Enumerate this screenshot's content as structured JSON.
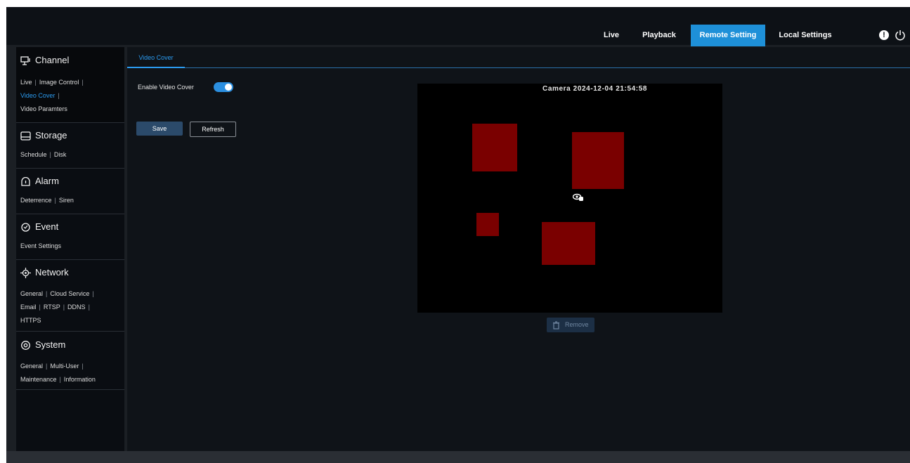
{
  "nav": {
    "items": [
      {
        "label": "Live",
        "active": false
      },
      {
        "label": "Playback",
        "active": false
      },
      {
        "label": "Remote Setting",
        "active": true
      },
      {
        "label": "Local Settings",
        "active": false
      }
    ],
    "accent_color": "#1e90d8",
    "icons": [
      "alert-icon",
      "power-icon"
    ]
  },
  "sidebar": {
    "sections": [
      {
        "title": "Channel",
        "icon": "monitor-icon",
        "lines": [
          [
            "Live",
            "Image Control"
          ],
          [
            "Video Cover"
          ],
          [
            "Video Paramters"
          ]
        ],
        "active_link": "Video Cover"
      },
      {
        "title": "Storage",
        "icon": "hard-drive-icon",
        "lines": [
          [
            "Schedule",
            "Disk"
          ]
        ]
      },
      {
        "title": "Alarm",
        "icon": "alarm-icon",
        "lines": [
          [
            "Deterrence",
            "Siren"
          ]
        ]
      },
      {
        "title": "Event",
        "icon": "event-icon",
        "lines": [
          [
            "Event Settings"
          ]
        ]
      },
      {
        "title": "Network",
        "icon": "network-icon",
        "lines": [
          [
            "General",
            "Cloud Service"
          ],
          [
            "Email",
            "RTSP",
            "DDNS"
          ],
          [
            "HTTPS"
          ]
        ]
      },
      {
        "title": "System",
        "icon": "gear-icon",
        "lines": [
          [
            "General",
            "Multi-User"
          ],
          [
            "Maintenance",
            "Information"
          ]
        ]
      }
    ]
  },
  "main": {
    "tab_label": "Video Cover",
    "enable_label": "Enable Video Cover",
    "enable_on": true,
    "save_label": "Save",
    "refresh_label": "Refresh",
    "remove_label": "Remove"
  },
  "video": {
    "osd_text": "Camera  2024-12-04 21:54:58",
    "mask_color": "#7a0000",
    "mask_count": 4
  }
}
